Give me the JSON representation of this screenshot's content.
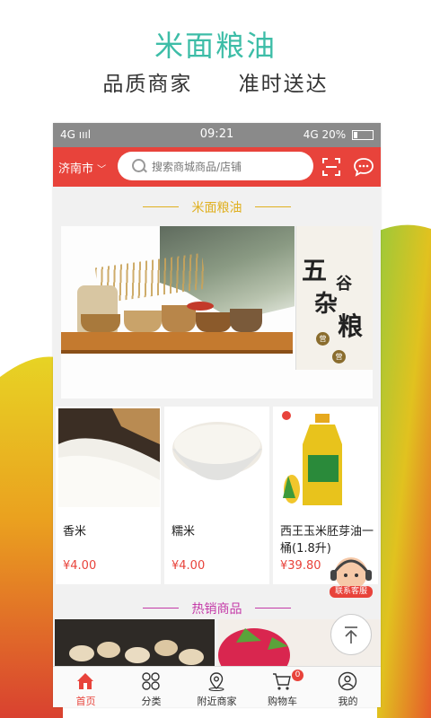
{
  "promo": {
    "title": "米面粮油",
    "subtitle_left": "品质商家",
    "subtitle_right": "准时送达"
  },
  "statusbar": {
    "left": "4G ıııl",
    "time": "09:21",
    "right": "4G 20%"
  },
  "header": {
    "city": "济南市",
    "search_placeholder": "搜索商城商品/店铺",
    "scan_icon": "scan-icon",
    "message_icon": "message-icon"
  },
  "section_title": "米面粮油",
  "banner": {
    "char1": "五",
    "char2": "谷",
    "char3": "杂",
    "char4": "粮",
    "stamp1": "营",
    "stamp2": "营"
  },
  "products": [
    {
      "name": "香米",
      "price": "¥4.00"
    },
    {
      "name": "糯米",
      "price": "¥4.00"
    },
    {
      "name": "西王玉米胚芽油一桶(1.8升)",
      "price": "¥39.80"
    }
  ],
  "hot_title": "热销商品",
  "service_label": "联系客服",
  "tabs": [
    {
      "label": "首页",
      "icon": "home-icon",
      "active": true
    },
    {
      "label": "分类",
      "icon": "category-icon"
    },
    {
      "label": "附近商家",
      "icon": "location-icon"
    },
    {
      "label": "购物车",
      "icon": "cart-icon",
      "badge": "0"
    },
    {
      "label": "我的",
      "icon": "user-icon"
    }
  ],
  "colors": {
    "accent": "#e8433b",
    "promo_title": "#3dbda7",
    "section_gold": "#e0b020",
    "hot_magenta": "#c43aa8"
  }
}
